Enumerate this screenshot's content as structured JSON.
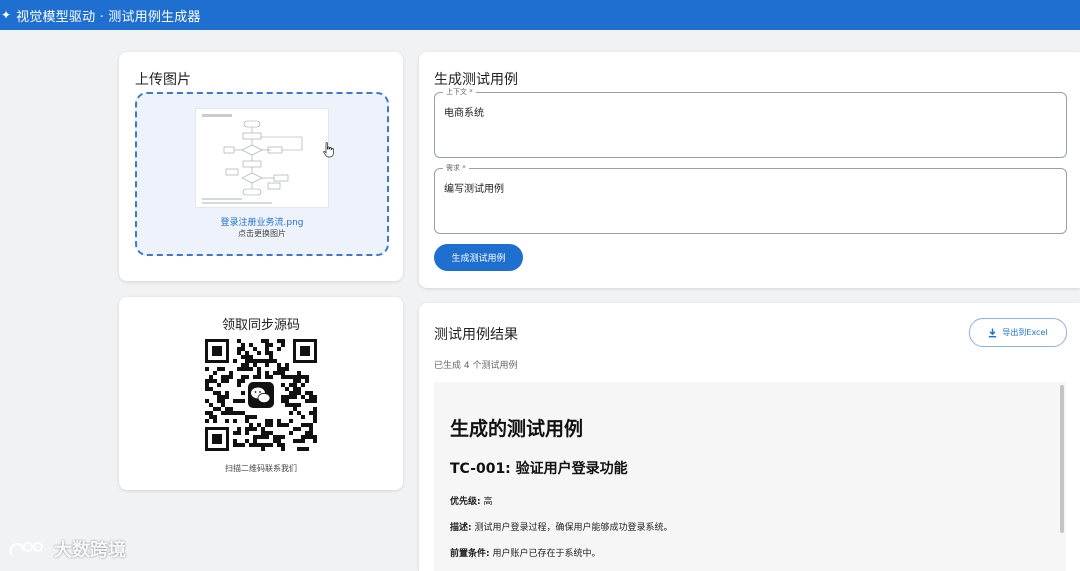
{
  "app": {
    "title": "视觉模型驱动 · 测试用例生成器",
    "accent": "#1f6fd1"
  },
  "upload": {
    "title": "上传图片",
    "file_name": "登录注册业务流.png",
    "hint": "点击更换图片"
  },
  "generate": {
    "title": "生成测试用例",
    "context_label": "上下文 *",
    "context_value": "电商系统",
    "requirement_label": "需求 *",
    "requirement_value": "编写测试用例",
    "button_label": "生成测试用例"
  },
  "qr": {
    "title": "领取同步源码",
    "caption": "扫描二维码联系我们",
    "icon": "wechat-icon"
  },
  "results": {
    "title": "测试用例结果",
    "export_label": "导出到Excel",
    "count_text": "已生成 4 个测试用例",
    "heading": "生成的测试用例",
    "case_title": "TC-001: 验证用户登录功能",
    "priority_key": "优先级:",
    "priority_value": "高",
    "description_key": "描述:",
    "description_value": "测试用户登录过程，确保用户能够成功登录系统。",
    "precondition_key": "前置条件:",
    "precondition_value": "用户账户已存在于系统中。"
  },
  "watermark": {
    "text": "大数跨境"
  }
}
